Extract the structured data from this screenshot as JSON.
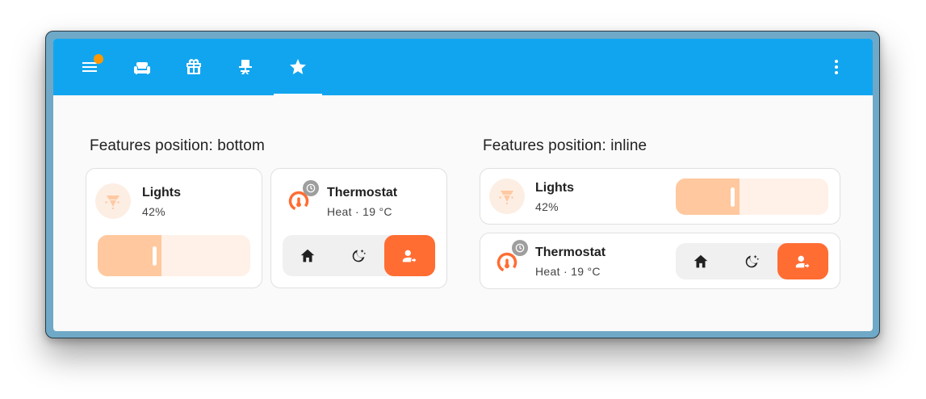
{
  "toolbar": {
    "menu_icon": "menu-icon",
    "notification_color": "#ff9800",
    "tabs": [
      {
        "icon": "sofa-icon"
      },
      {
        "icon": "gift-icon"
      },
      {
        "icon": "desk-chair-icon"
      },
      {
        "icon": "star-icon",
        "selected": true
      }
    ],
    "overflow_icon": "dots-vertical-icon",
    "background": "#12a5ef"
  },
  "sections": {
    "bottom": {
      "title": "Features position: bottom",
      "lights": {
        "name": "Lights",
        "state": "42%",
        "brightness_percent": 42
      },
      "thermostat": {
        "name": "Thermostat",
        "state": "Heat · 19 °C",
        "modes": [
          "home-icon",
          "sleep-icon",
          "away-icon"
        ],
        "active_mode": 2
      }
    },
    "inline": {
      "title": "Features position: inline",
      "lights": {
        "name": "Lights",
        "state": "42%",
        "brightness_percent": 42
      },
      "thermostat": {
        "name": "Thermostat",
        "state": "Heat · 19 °C",
        "modes": [
          "home-icon",
          "sleep-icon",
          "away-icon"
        ],
        "active_mode": 2
      }
    }
  },
  "colors": {
    "accent_orange": "#ff6d33",
    "light_fill": "#ffc89e",
    "light_track": "#fff1e8"
  }
}
